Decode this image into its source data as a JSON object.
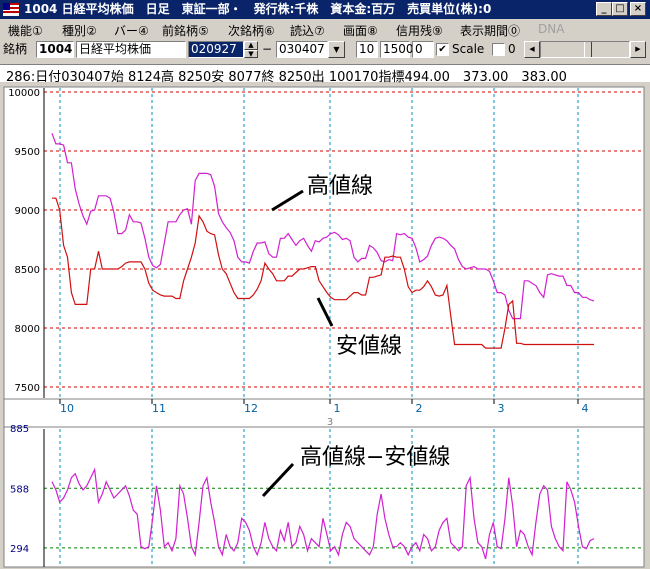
{
  "window": {
    "title": "1004 日経平均株価　日足　東証一部・　発行株:千株　資本金:百万　売買単位(株):0",
    "minimize": "_",
    "maximize": "□",
    "close": "×"
  },
  "menu": [
    {
      "label": "機能①"
    },
    {
      "label": "種別②"
    },
    {
      "label": "バー④"
    },
    {
      "label": "前銘柄⑤"
    },
    {
      "label": "次銘柄⑥"
    },
    {
      "label": "読込⑦"
    },
    {
      "label": "画面⑧"
    },
    {
      "label": "信用残⑨"
    },
    {
      "label": "表示期間⓪"
    },
    {
      "label": "DNA"
    }
  ],
  "toolbar": {
    "code_label": "銘柄",
    "code": "1004",
    "name": "日経平均株価",
    "from_date": "020927",
    "dash": "−",
    "to_date": "030407",
    "val1": "10",
    "val2": "1500",
    "val3": "0",
    "scale_checked": "✔",
    "scale_label": "Scale",
    "val4": "0",
    "dropdown_arrow": "▼",
    "spin_up": "▲",
    "spin_down": "▼",
    "scroll_left": "◀",
    "scroll_right": "▶"
  },
  "info_line": "286:日付030407始 8124高 8250安 8077終 8250出 100170指標494.00　373.00　383.00",
  "icons": [
    "app-flag-icon",
    "spin-icon",
    "dropdown-arrow-icon",
    "scroll-left-icon",
    "scroll-right-icon"
  ],
  "chart_data": [
    {
      "type": "line",
      "ylim": [
        7500,
        10000
      ],
      "y_ticks": [
        "10000",
        "9500",
        "9000",
        "8500",
        "8000",
        "7500"
      ],
      "x_ticks": [
        "10",
        "11",
        "12",
        "1",
        "2",
        "3",
        "4"
      ],
      "year_label": "3",
      "x": [
        0,
        1,
        2,
        3,
        4,
        5,
        6,
        7,
        8,
        9,
        10,
        11,
        12,
        13,
        14,
        15,
        16,
        17,
        18,
        19,
        20,
        21,
        22,
        23,
        24,
        25,
        26,
        27,
        28,
        29,
        30,
        31,
        32,
        33,
        34,
        35,
        36,
        37,
        38,
        39,
        40,
        41,
        42,
        43,
        44,
        45,
        46,
        47,
        48,
        49,
        50,
        51,
        52,
        53,
        54,
        55,
        56,
        57,
        58,
        59,
        60,
        61,
        62,
        63,
        64,
        65,
        66,
        67,
        68,
        69,
        70,
        71,
        72,
        73,
        74,
        75,
        76,
        77,
        78,
        79,
        80,
        81,
        82,
        83,
        84,
        85,
        86,
        87,
        88,
        89,
        90,
        91,
        92,
        93,
        94,
        95,
        96,
        97,
        98,
        99,
        100,
        101,
        102,
        103,
        104,
        105,
        106,
        107,
        108,
        109,
        110,
        111,
        112,
        113,
        114,
        115,
        116,
        117,
        118,
        119,
        120,
        121,
        122,
        123,
        124,
        125,
        126,
        127,
        128,
        129,
        130,
        131,
        132,
        133,
        134,
        135,
        136,
        137,
        138,
        139,
        140
      ],
      "series": [
        {
          "name": "高値線",
          "color": "#d020d0",
          "values": [
            9650,
            9560,
            9560,
            9550,
            9400,
            9400,
            9180,
            9050,
            8950,
            8880,
            8990,
            9000,
            9120,
            9120,
            9120,
            9100,
            8980,
            8800,
            8800,
            8830,
            8960,
            8900,
            8900,
            8890,
            8760,
            8600,
            8530,
            8510,
            8540,
            8720,
            8900,
            8900,
            8900,
            8960,
            9000,
            9010,
            8880,
            9250,
            9310,
            9310,
            9310,
            9300,
            9200,
            8970,
            8900,
            8850,
            8810,
            8740,
            8600,
            8560,
            8560,
            8550,
            8650,
            8720,
            8720,
            8730,
            8630,
            8600,
            8600,
            8760,
            8760,
            8800,
            8750,
            8700,
            8740,
            8760,
            8700,
            8650,
            8740,
            8730,
            8760,
            8770,
            8800,
            8810,
            8790,
            8750,
            8760,
            8740,
            8600,
            8560,
            8590,
            8590,
            8700,
            8680,
            8640,
            8570,
            8560,
            8580,
            8570,
            8800,
            8790,
            8800,
            8770,
            8760,
            8680,
            8560,
            8580,
            8610,
            8700,
            8760,
            8770,
            8760,
            8740,
            8700,
            8670,
            8580,
            8520,
            8500,
            8510,
            8520,
            8500,
            8500,
            8500,
            8480,
            8400,
            8300,
            8300,
            8280,
            8150,
            8080,
            8080,
            8080,
            8400,
            8400,
            8380,
            8360,
            8300,
            8260,
            8450,
            8460,
            8450,
            8440,
            8440,
            8360,
            8360,
            8300,
            8300,
            8260,
            8260,
            8240,
            8230
          ]
        },
        {
          "name": "安値線",
          "color": "#d01010",
          "values": [
            9100,
            9100,
            9000,
            8700,
            8600,
            8300,
            8200,
            8200,
            8200,
            8200,
            8500,
            8500,
            8650,
            8500,
            8500,
            8500,
            8500,
            8500,
            8520,
            8550,
            8560,
            8560,
            8560,
            8560,
            8500,
            8380,
            8320,
            8300,
            8280,
            8270,
            8270,
            8270,
            8250,
            8250,
            8400,
            8500,
            8600,
            8720,
            8950,
            8900,
            8820,
            8800,
            8790,
            8620,
            8500,
            8460,
            8380,
            8300,
            8250,
            8250,
            8250,
            8250,
            8280,
            8330,
            8400,
            8550,
            8500,
            8460,
            8400,
            8400,
            8400,
            8440,
            8440,
            8470,
            8500,
            8500,
            8510,
            8520,
            8520,
            8400,
            8350,
            8300,
            8260,
            8240,
            8240,
            8240,
            8240,
            8270,
            8300,
            8300,
            8280,
            8280,
            8430,
            8430,
            8440,
            8450,
            8600,
            8600,
            8610,
            8600,
            8600,
            8500,
            8350,
            8300,
            8320,
            8320,
            8350,
            8400,
            8350,
            8280,
            8270,
            8280,
            8360,
            8100,
            7860,
            7860,
            7860,
            7860,
            7860,
            7860,
            7860,
            7860,
            7830,
            7830,
            7830,
            7830,
            7830,
            8000,
            8200,
            8230,
            7870,
            7870,
            7860,
            7860,
            7860,
            7860,
            7860,
            7860,
            7860,
            7860,
            7860,
            7860,
            7860,
            7860,
            7860,
            7860,
            7860,
            7860,
            7860,
            7860,
            7860
          ]
        }
      ]
    },
    {
      "type": "line",
      "ylim": [
        200,
        890
      ],
      "y_ticks": [
        "588",
        "294"
      ],
      "series": [
        {
          "name": "高値線−安値線",
          "color": "#d020d0",
          "values": [
            620,
            580,
            520,
            540,
            580,
            640,
            660,
            610,
            580,
            600,
            640,
            680,
            520,
            560,
            620,
            580,
            540,
            560,
            580,
            600,
            550,
            480,
            460,
            300,
            290,
            300,
            440,
            600,
            480,
            300,
            320,
            280,
            340,
            600,
            560,
            440,
            300,
            260,
            420,
            600,
            640,
            520,
            420,
            300,
            260,
            360,
            300,
            280,
            320,
            440,
            420,
            380,
            300,
            260,
            320,
            420,
            340,
            300,
            280,
            380,
            330,
            420,
            300,
            320,
            400,
            360,
            280,
            340,
            320,
            300,
            440,
            360,
            280,
            300,
            260,
            360,
            420,
            400,
            340,
            320,
            300,
            280,
            260,
            300,
            460,
            560,
            440,
            360,
            300,
            300,
            320,
            300,
            260,
            300,
            320,
            280,
            360,
            340,
            280,
            300,
            380,
            420,
            440,
            320,
            300,
            280,
            300,
            600,
            640,
            440,
            320,
            300,
            240,
            360,
            420,
            300,
            290,
            440,
            640,
            500,
            300,
            380,
            360,
            300,
            260,
            420,
            560,
            600,
            580,
            400,
            340,
            300,
            280,
            620,
            580,
            520,
            400,
            300,
            290,
            330,
            340
          ]
        }
      ]
    }
  ],
  "annotations": {
    "high_line": "高値線",
    "low_line": "安値線",
    "diff_line": "高値線−安値線",
    "lower_top_tick": "885"
  }
}
